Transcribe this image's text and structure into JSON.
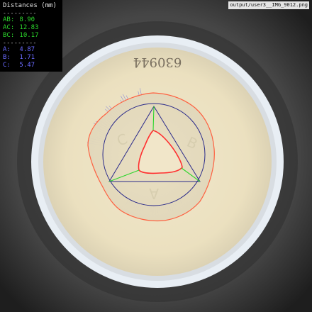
{
  "overlay": {
    "title": "Distances (mm)",
    "separator": "---------",
    "edges": [
      {
        "label": "AB:",
        "value": "8.90",
        "color": "#2cd62c"
      },
      {
        "label": "AC:",
        "value": "12.83",
        "color": "#2cd62c"
      },
      {
        "label": "BC:",
        "value": "10.17",
        "color": "#2cd62c"
      }
    ],
    "vertices": [
      {
        "label": "A:",
        "value": "4.87",
        "color": "#5a5aff"
      },
      {
        "label": "B:",
        "value": "1.71",
        "color": "#5a5aff"
      },
      {
        "label": "C:",
        "value": "5.47",
        "color": "#5a5aff"
      }
    ]
  },
  "file": {
    "name": "output/user3__IMG_9012.png"
  },
  "plate": {
    "handwriting": "630944"
  },
  "disc_labels": [
    "C",
    "B",
    "A"
  ],
  "colors": {
    "background": "#3a3a3a",
    "plate_rim": "#e8eef4",
    "agar": "#efe6c8",
    "outer_contour": "#ff5a3a",
    "inner_contour": "#ff3030",
    "triangle": "#2a2a8a",
    "median_lines": "#2cd62c",
    "hatch": "#7a7adc"
  }
}
